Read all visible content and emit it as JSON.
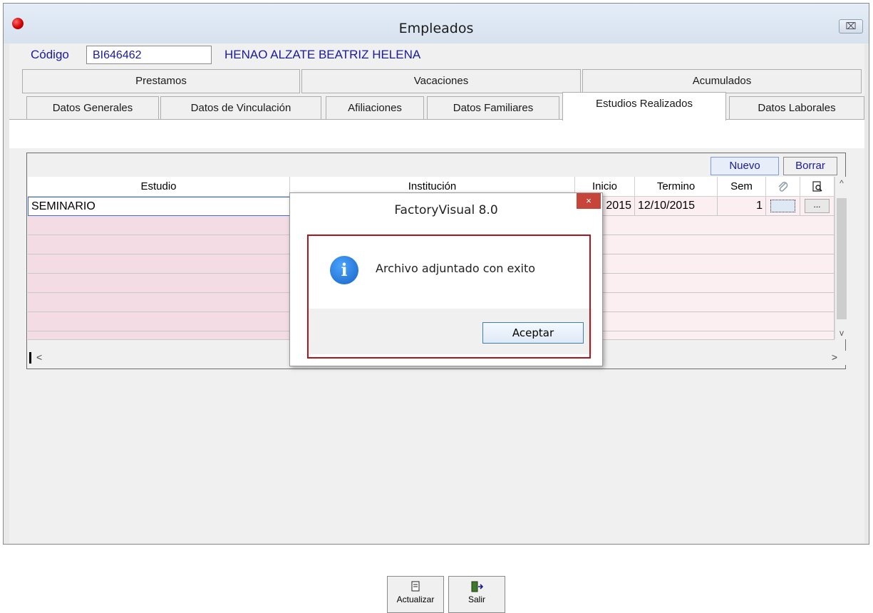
{
  "window": {
    "title": "Empleados",
    "close_glyph": "⌧"
  },
  "header": {
    "code_label": "Código",
    "code_value": "BI646462",
    "employee_name": "HENAO ALZATE BEATRIZ HELENA"
  },
  "tabs_top": [
    {
      "label": "Prestamos"
    },
    {
      "label": "Vacaciones"
    },
    {
      "label": "Acumulados"
    }
  ],
  "tabs_bottom": [
    {
      "label": "Datos Generales"
    },
    {
      "label": "Datos de Vinculación"
    },
    {
      "label": "Afiliaciones"
    },
    {
      "label": "Datos Familiares"
    },
    {
      "label": "Estudios Realizados",
      "active": true
    },
    {
      "label": "Datos Laborales"
    }
  ],
  "grid": {
    "toolbar": {
      "new_label": "Nuevo",
      "delete_label": "Borrar"
    },
    "columns": [
      "Estudio",
      "Institución",
      "Inicio",
      "Termino",
      "Sem"
    ],
    "rows": [
      {
        "estudio": "SEMINARIO",
        "institucion": "",
        "inicio": "2015",
        "termino": "12/10/2015",
        "sem": "1",
        "attach": "",
        "view": "..."
      }
    ],
    "scroll": {
      "left": "<",
      "right": ">",
      "up": "^",
      "down": "v"
    }
  },
  "buttons": {
    "update_label": "Actualizar",
    "exit_label": "Salir"
  },
  "dialog": {
    "title": "FactoryVisual 8.0",
    "close_glyph": "×",
    "message": "Archivo adjuntado con exito",
    "ok_label": "Aceptar",
    "icon_glyph": "i"
  },
  "icons": {
    "attach": "paperclip-icon",
    "view": "magnifier-document-icon",
    "info": "info-icon"
  }
}
